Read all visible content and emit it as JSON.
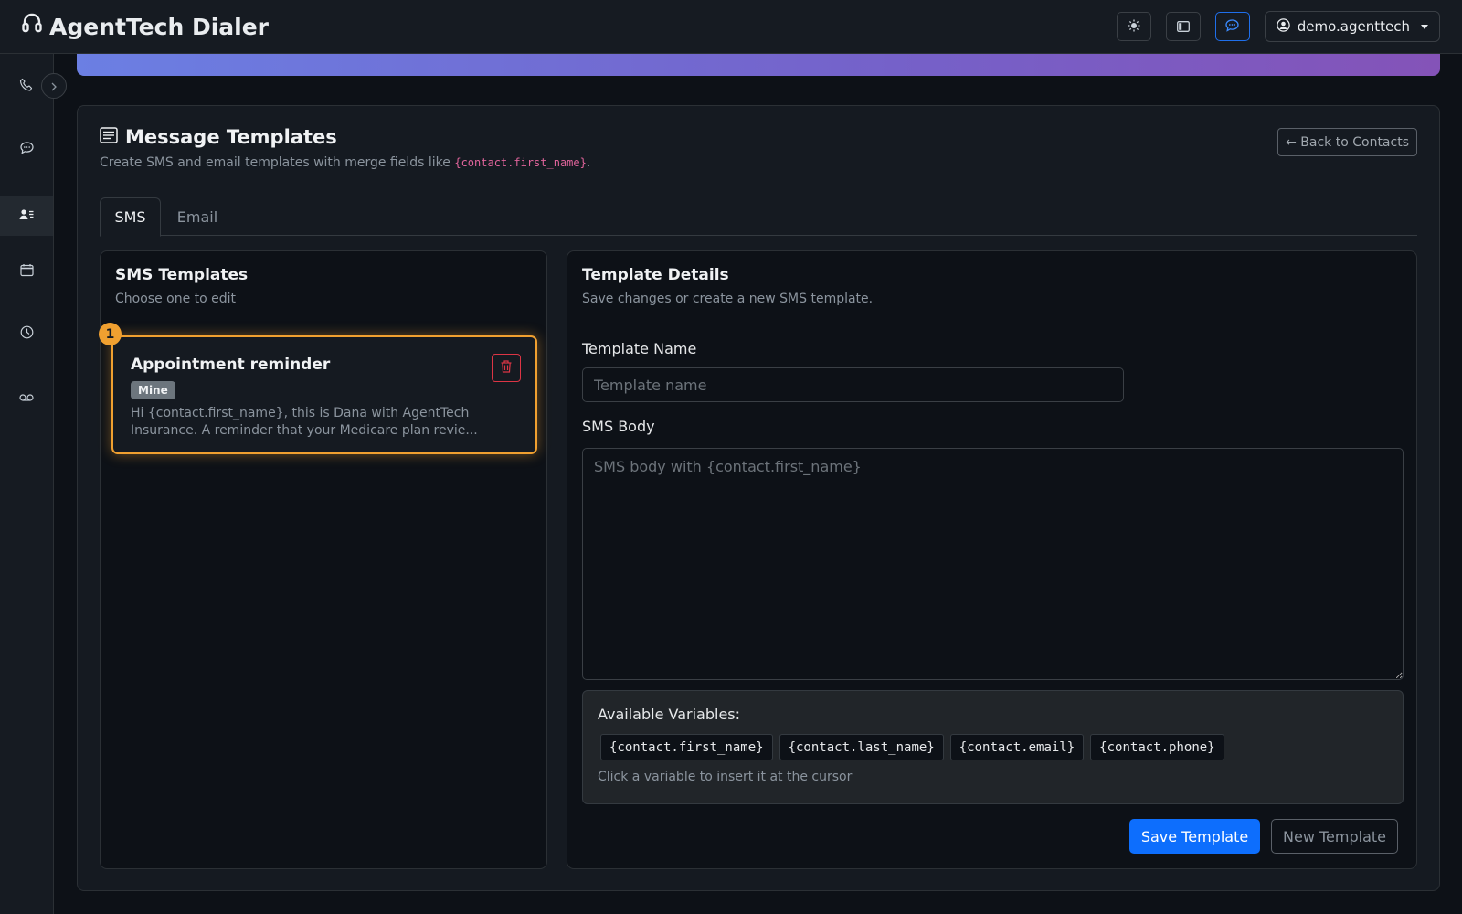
{
  "app": {
    "title": "AgentTech Dialer"
  },
  "header": {
    "theme_toggle_icon": "sun-icon",
    "layout_toggle_icon": "sidebar-icon",
    "chat_toggle_icon": "chat-icon",
    "user_label": "demo.agenttech"
  },
  "sidebar": {
    "items": [
      {
        "icon": "phone-icon",
        "active": false
      },
      {
        "icon": "chat-icon",
        "active": false
      },
      {
        "icon": "contacts-icon",
        "active": true
      },
      {
        "icon": "calendar-icon",
        "active": false
      },
      {
        "icon": "clock-icon",
        "active": false
      },
      {
        "icon": "voicemail-icon",
        "active": false
      }
    ]
  },
  "page": {
    "title": "Message Templates",
    "subtitle_prefix": "Create SMS and email templates with merge fields like ",
    "subtitle_code": "{contact.first_name}",
    "subtitle_suffix": ".",
    "back_label": "← Back to Contacts"
  },
  "tabs": [
    {
      "label": "SMS",
      "active": true
    },
    {
      "label": "Email",
      "active": false
    }
  ],
  "list_panel": {
    "title": "SMS Templates",
    "subtitle": "Choose one to edit",
    "templates": [
      {
        "marker": "1",
        "name": "Appointment reminder",
        "tag": "Mine",
        "preview": "Hi {contact.first_name}, this is Dana with AgentTech Insurance. A reminder that your Medicare plan revie..."
      }
    ]
  },
  "details_panel": {
    "title": "Template Details",
    "subtitle": "Save changes or create a new SMS template.",
    "name_label": "Template Name",
    "name_value": "",
    "name_placeholder": "Template name",
    "body_label": "SMS Body",
    "body_value": "",
    "body_placeholder": "SMS body with {contact.first_name}",
    "variables_title": "Available Variables:",
    "variables": [
      "{contact.first_name}",
      "{contact.last_name}",
      "{contact.email}",
      "{contact.phone}"
    ],
    "variables_hint": "Click a variable to insert it at the cursor",
    "save_label": "Save Template",
    "new_label": "New Template"
  },
  "colors": {
    "accent": "#0d6efd",
    "highlight": "#f0a030",
    "danger": "#dc3545",
    "code": "#e0649b"
  }
}
